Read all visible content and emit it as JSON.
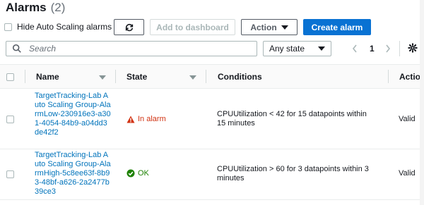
{
  "header": {
    "title": "Alarms",
    "count": "(2)"
  },
  "toolbar": {
    "hide_autoscaling_label": "Hide Auto Scaling alarms",
    "refresh_icon": "refresh-icon",
    "add_dashboard_label": "Add to dashboard",
    "action_label": "Action",
    "create_alarm_label": "Create alarm"
  },
  "filter": {
    "search_placeholder": "Search",
    "state_value": "Any state",
    "page_number": "1"
  },
  "table": {
    "columns": [
      "Name",
      "State",
      "Conditions",
      "Action"
    ],
    "rows": [
      {
        "name": "TargetTracking-Lab Auto Scaling Group-AlarmLow-230916e3-a301-4054-84b9-a04dd3de42f2",
        "state": "In alarm",
        "condition": "CPUUtilization < 42 for 15 datapoints within 15 minutes",
        "action": "Valid"
      },
      {
        "name": "TargetTracking-Lab Auto Scaling Group-AlarmHigh-5c8ee63f-8b93-48bf-a626-2a2477b39ce3",
        "state": "OK",
        "condition": "CPUUtilization > 60 for 3 datapoints within 3 minutes",
        "action": "Valid"
      }
    ]
  },
  "colors": {
    "primary": "#0972d3",
    "alarm": "#d13212",
    "ok": "#1d8102",
    "link": "#0073bb"
  }
}
